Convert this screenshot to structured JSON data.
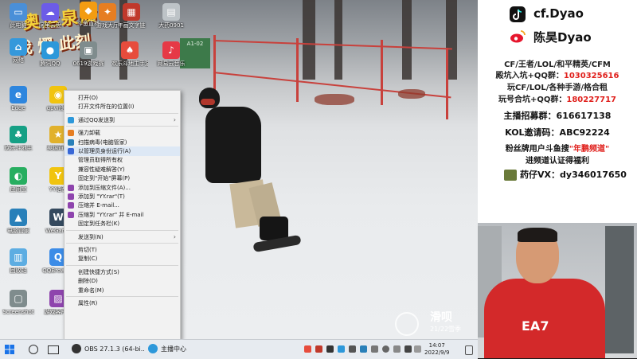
{
  "desktop": {
    "logo_line1": "奥运泉质",
    "logo_line2": "我 燿 此刻",
    "icons": [
      {
        "label": "此电脑",
        "color": "#4a8fd8",
        "glyph": "▭"
      },
      {
        "label": "阿里云盘",
        "color": "#6c5ce7",
        "glyph": "☁"
      },
      {
        "label": "斗鱼直播",
        "color": "#f39c12",
        "glyph": "◆"
      },
      {
        "label": "游戏大厅",
        "color": "#e67e22",
        "glyph": "✦"
      },
      {
        "label": "年画文字链",
        "color": "#c0392b",
        "glyph": "▦"
      },
      {
        "label": "大药0901",
        "color": "#bdc3c7",
        "glyph": "▤"
      },
      {
        "label": "网络",
        "color": "#3498db",
        "glyph": "⌂"
      },
      {
        "label": "腾讯QQ",
        "color": "#2d98da",
        "glyph": "●"
      },
      {
        "label": "0619游戏赛",
        "color": "#7f8c8d",
        "glyph": "▣"
      },
      {
        "label": "欢乐斗地主手游电脑版",
        "color": "#e74c3c",
        "glyph": "♠"
      },
      {
        "label": "网易云音乐",
        "color": "#e63946",
        "glyph": "♪"
      },
      {
        "label": "Edge",
        "color": "#2e86de",
        "glyph": "e"
      },
      {
        "label": "gpw设置",
        "color": "#f1c40f",
        "glyph": "◉"
      },
      {
        "label": "欢乐斗地主",
        "color": "#16a085",
        "glyph": "♣"
      },
      {
        "label": "奥运直播",
        "color": "#e1b12c",
        "glyph": "★"
      },
      {
        "label": "应用宝",
        "color": "#27ae60",
        "glyph": "◐"
      },
      {
        "label": "YY语音",
        "color": "#f1c40f",
        "glyph": "Y"
      },
      {
        "label": "电脑管家",
        "color": "#2980b9",
        "glyph": "▲"
      },
      {
        "label": "WeGame",
        "color": "#34495e",
        "glyph": "W"
      },
      {
        "label": "回收站",
        "color": "#5dade2",
        "glyph": "▥"
      },
      {
        "label": "QQBrowser",
        "color": "#3c8ce7",
        "glyph": "Q"
      },
      {
        "label": "Screenshot",
        "color": "#7f8c8d",
        "glyph": "▢"
      },
      {
        "label": "游戏客户端",
        "color": "#8e44ad",
        "glyph": "▨"
      }
    ],
    "banner_text": "A1-02",
    "watermark_title": "滑呗",
    "watermark_sub": "21/22雪季"
  },
  "context_menu": {
    "items": [
      {
        "label": "打开(O)",
        "icon_color": "",
        "submenu": false
      },
      {
        "label": "打开文件所在的位置(I)",
        "icon_color": "",
        "submenu": false
      },
      {
        "sep": true
      },
      {
        "label": "通过QQ发送到",
        "icon_color": "#2d98da",
        "submenu": true
      },
      {
        "sep": true
      },
      {
        "label": "强力卸载",
        "icon_color": "#e67e22",
        "submenu": false
      },
      {
        "label": "扫描病毒(电脑管家)",
        "icon_color": "#2980b9",
        "submenu": false
      },
      {
        "label": "以管理员身份运行(A)",
        "icon_color": "#3867d6",
        "submenu": false,
        "highlight": true
      },
      {
        "label": "管理员取得所有权",
        "icon_color": "",
        "submenu": false
      },
      {
        "label": "兼容性疑难解答(Y)",
        "icon_color": "",
        "submenu": false
      },
      {
        "label": "固定到\"开始\"屏幕(P)",
        "icon_color": "",
        "submenu": false
      },
      {
        "label": "添加到压缩文件(A)...",
        "icon_color": "#8e44ad",
        "submenu": false
      },
      {
        "label": "添加到 \"YY.rar\"(T)",
        "icon_color": "#8e44ad",
        "submenu": false
      },
      {
        "label": "压缩并 E-mail...",
        "icon_color": "#8e44ad",
        "submenu": false
      },
      {
        "label": "压缩到 \"YY.rar\" 并 E-mail",
        "icon_color": "#8e44ad",
        "submenu": false
      },
      {
        "label": "固定到任务栏(K)",
        "icon_color": "",
        "submenu": false
      },
      {
        "sep": true
      },
      {
        "label": "发送到(N)",
        "icon_color": "",
        "submenu": true
      },
      {
        "sep": true
      },
      {
        "label": "剪切(T)",
        "icon_color": "",
        "submenu": false
      },
      {
        "label": "复制(C)",
        "icon_color": "",
        "submenu": false
      },
      {
        "sep": true
      },
      {
        "label": "创建快捷方式(S)",
        "icon_color": "",
        "submenu": false
      },
      {
        "label": "删除(D)",
        "icon_color": "",
        "submenu": false
      },
      {
        "label": "重命名(M)",
        "icon_color": "",
        "submenu": false
      },
      {
        "sep": true
      },
      {
        "label": "属性(R)",
        "icon_color": "",
        "submenu": false
      }
    ]
  },
  "taskbar": {
    "obs_label": "OBS 27.1.3 (64-bi...",
    "streamer_label": "主播中心",
    "time": "14:07",
    "date": "2022/9/9"
  },
  "panel": {
    "handle_tiktok": "cf.Dyao",
    "handle_weibo": "陈昊Dyao",
    "line1": "CF/王者/LOL/和平精英/CFM",
    "line2_prefix": "殿坑入坑+QQ群：",
    "line2_value": "1030325616",
    "line3": "玩CF/LOL/各种手游/格合租",
    "line4_prefix": "玩号合坑+QQ群：",
    "line4_value": "180227717",
    "line5": "主播招募群：616617138",
    "line6": "KOL邀请码：ABC92224",
    "line7_prefix": "粉丝牌用户斗鱼搜",
    "line7_highlight": "\"年鹏频道\"",
    "line8": "进频道认证得福利",
    "line9": "药仔VX：dy346017650"
  },
  "webcam": {
    "shirt_text": "EA7"
  },
  "colors": {
    "accent_red": "#e0201c",
    "menu_highlight": "#dde8f5",
    "taskbar_bg": "#e7ebf0"
  }
}
